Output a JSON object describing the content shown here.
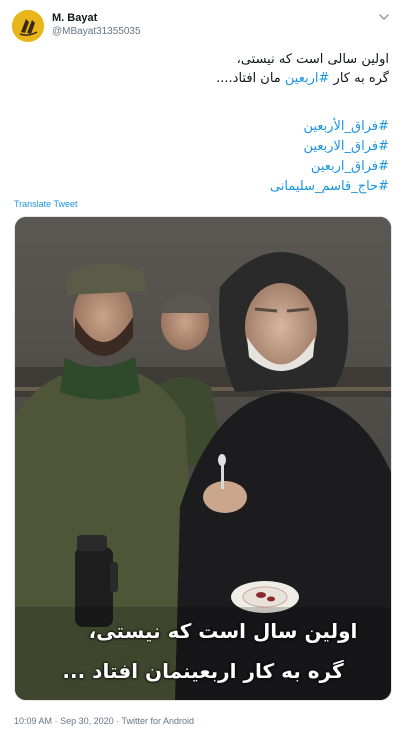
{
  "user": {
    "display_name": "M. Bayat",
    "handle": "@MBayat31355035"
  },
  "tweet": {
    "line1": "اولین سالی است که نیستی،",
    "line2_prefix": "گره به کار ",
    "line2_hashtag": "#اربعین",
    "line2_suffix": " مان افتاد....",
    "hashtags": [
      "#فراق_الأربعین",
      "#فراق_الاربعین",
      "#فراق_اربعین",
      "#حاج_قاسم_سلیمانی"
    ],
    "translate_label": "Translate Tweet"
  },
  "media": {
    "caption_line1": "اولین سال است که نیستی،",
    "caption_line2": "گره به کار اربعینمان افتاد ..."
  },
  "meta": {
    "time": "10:09 AM",
    "separator": "·",
    "date": "Sep 30, 2020",
    "source": "Twitter for Android"
  },
  "icons": {
    "chevron": "chevron-down-icon"
  },
  "colors": {
    "link": "#1b95e0",
    "secondary_text": "#657786",
    "avatar": "#e8b51a"
  }
}
